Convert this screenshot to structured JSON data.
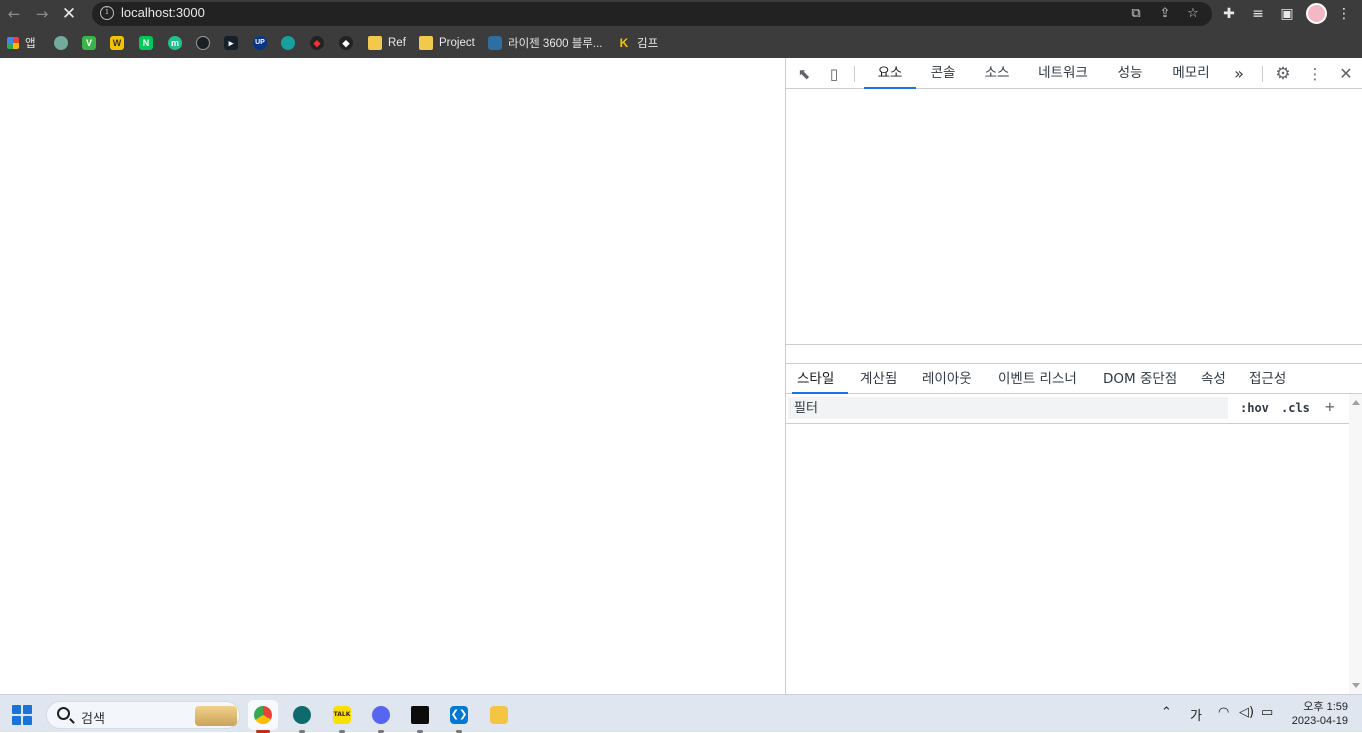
{
  "browser": {
    "url": "localhost:3000",
    "back_icon": "arrow-left-icon",
    "forward_icon": "arrow-right-icon",
    "stop_icon": "close-icon"
  },
  "bookmarks": {
    "apps_label": "앱",
    "ref_label": "Ref",
    "project_label": "Project",
    "rize_label": "라이젠 3600 블루...",
    "kimp_label": "김프"
  },
  "devtools": {
    "tabs": [
      "요소",
      "콘솔",
      "소스",
      "네트워크",
      "성능",
      "메모리"
    ],
    "more_label": "»",
    "styles_tabs": [
      "스타일",
      "계산됨",
      "레이아웃",
      "이벤트 리스너",
      "DOM 중단점",
      "속성",
      "접근성"
    ],
    "filter_placeholder": "필터",
    "hov_label": ":hov",
    "cls_label": ".cls",
    "add_label": "+"
  },
  "taskbar": {
    "search_placeholder": "검색",
    "ime_label": "가",
    "clock_time": "오후 1:59",
    "clock_date": "2023-04-19"
  },
  "colors": {
    "chrome_dark": "#3c3c3c",
    "devtools_accent": "#1a73e8",
    "taskbar_bg": "#dfe6ef"
  }
}
